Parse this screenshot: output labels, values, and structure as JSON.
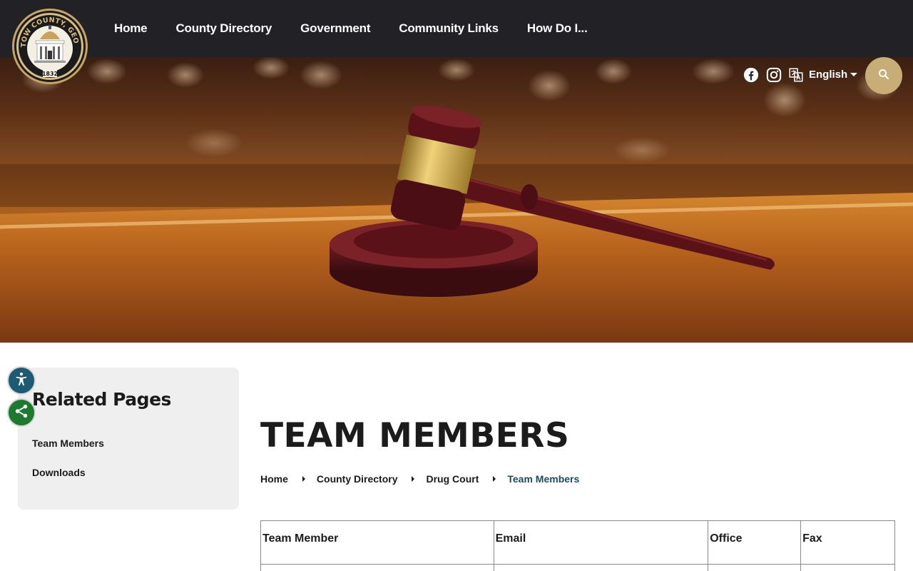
{
  "header": {
    "seal": {
      "text_top": "BARTOW COUNTY, GEORGIA",
      "year": "1832"
    },
    "nav": [
      "Home",
      "County Directory",
      "Government",
      "Community Links",
      "How Do I..."
    ]
  },
  "utility": {
    "social_icons": [
      "facebook-icon",
      "instagram-icon"
    ],
    "translate_icon": "translate-icon",
    "language": "English",
    "search_icon": "search-icon"
  },
  "sidebar": {
    "title": "Related Pages",
    "links": [
      "Team Members",
      "Downloads"
    ]
  },
  "side_tools": [
    "accessibility-icon",
    "share-icon"
  ],
  "main": {
    "title": "TEAM MEMBERS",
    "breadcrumb": [
      "Home",
      "County Directory",
      "Drug Court",
      "Team Members"
    ],
    "table": {
      "columns": [
        "Team Member",
        "Email",
        "Office",
        "Fax"
      ]
    }
  },
  "colors": {
    "header_bg": "#222226",
    "search_bg": "#c9ad77",
    "accessibility_bg": "#1d5a74",
    "share_bg": "#1b7a2d",
    "breadcrumb_current": "#1d4a63"
  }
}
